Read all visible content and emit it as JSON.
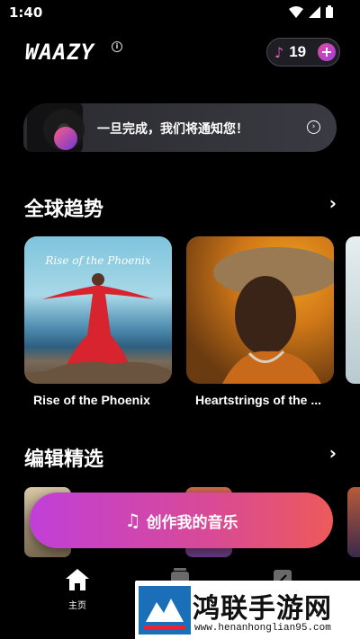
{
  "status": {
    "time": "1:40"
  },
  "header": {
    "logo": "WAAZY",
    "credits": "19",
    "plus": "+"
  },
  "banner": {
    "text": "一旦完成，我们将通知您！"
  },
  "sections": {
    "trending": {
      "title": "全球趋势"
    },
    "editors": {
      "title": "编辑精选"
    }
  },
  "trending_cards": [
    {
      "title": "Rise of the Phoenix",
      "cover_text": "Rise of the Phoenix"
    },
    {
      "title": "Heartstrings of the ..."
    }
  ],
  "cta": {
    "label": "创作我的音乐"
  },
  "nav": {
    "home": "主页"
  },
  "watermark": {
    "title": "鸿联手游网",
    "url": "www.henanhonglian95.com"
  },
  "colors": {
    "accent": "#d84a95",
    "cta_start": "#c13fd8",
    "cta_end": "#ee5a5a",
    "background": "#000000"
  }
}
